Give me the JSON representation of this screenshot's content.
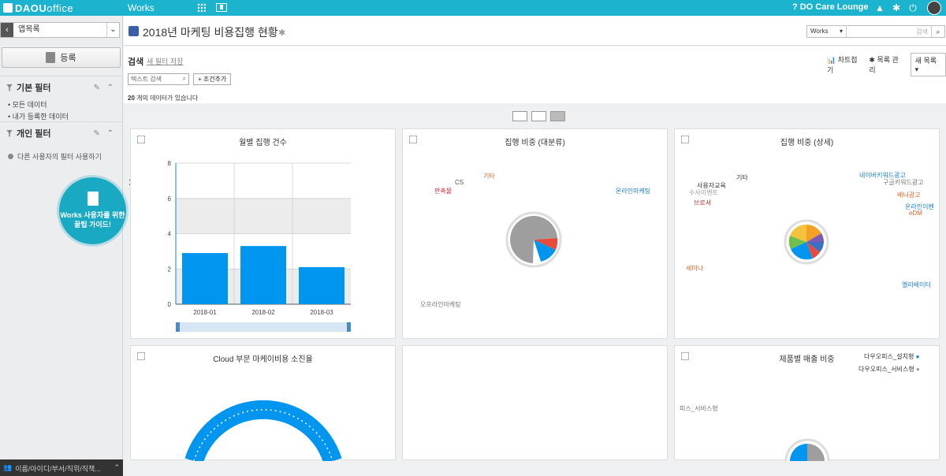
{
  "topbar": {
    "logo_bold": "DAOU",
    "logo_light": "office",
    "app_name": "Works",
    "lounge": "DO Care Lounge"
  },
  "sidebar": {
    "select_value": "앱목록",
    "register_label": "등록",
    "basic_filter": "기본 필터",
    "basic_items": [
      "모든 데이터",
      "내가 등록한 데이터"
    ],
    "personal_filter": "개인 필터",
    "other_user_filter": "다른 사용자의 필터 사용하기",
    "guide_text_1": "Works 사용자를 위한",
    "guide_text_2": "꿀팁 가이드!",
    "bottom_search": "이름/아이디/부서/직위/직책..."
  },
  "header": {
    "title": "2018년 마케팅 비용집행 현황",
    "search_select": "Works",
    "search_placeholder": "검색"
  },
  "filter": {
    "label": "검색",
    "save_link": "새 필터 저장",
    "chart_collapse": "차트접기",
    "list_manage": "목록 관리",
    "new_list": "새 목록",
    "text_search_placeholder": "텍스트 검색",
    "add_condition": "+ 조건추가",
    "count_bold": "20",
    "count_text": " 개의 데이터가 있습니다"
  },
  "cards": {
    "c1_title": "월별 집행 건수",
    "c2_title": "집행 비중 (대분류)",
    "c3_title": "집행 비중 (상세)",
    "c4_title": "Cloud 부문 마케이비용 소진율",
    "c6_title": "제품별 매출 비중"
  },
  "pie1_labels": [
    "기타",
    "CS",
    "판촉물",
    "온라인마케팅",
    "오프라인마케팅"
  ],
  "pie2_labels": [
    "네이버키워드광고",
    "구글키워드광고",
    "기타",
    "사용자교육",
    "수사이벤트",
    "배너광고",
    "브로셔",
    "온라인이벤",
    "eDM",
    "세미나",
    "엘리베이터"
  ],
  "pie3_labels": [
    "다우오피스_설치형",
    "다우오피스_서비스형",
    "피스_서비스형"
  ],
  "colors": {
    "accent": "#1bb3cd",
    "bar": "#0096f0"
  },
  "chart_data": {
    "type": "bar",
    "title": "월별 집행 건수",
    "categories": [
      "2018-01",
      "2018-02",
      "2018-03"
    ],
    "values": [
      2.9,
      3.3,
      2.1
    ],
    "ylim": [
      0,
      8
    ],
    "yticks": [
      "0",
      "2",
      "4",
      "6",
      "8"
    ],
    "grid": true
  }
}
